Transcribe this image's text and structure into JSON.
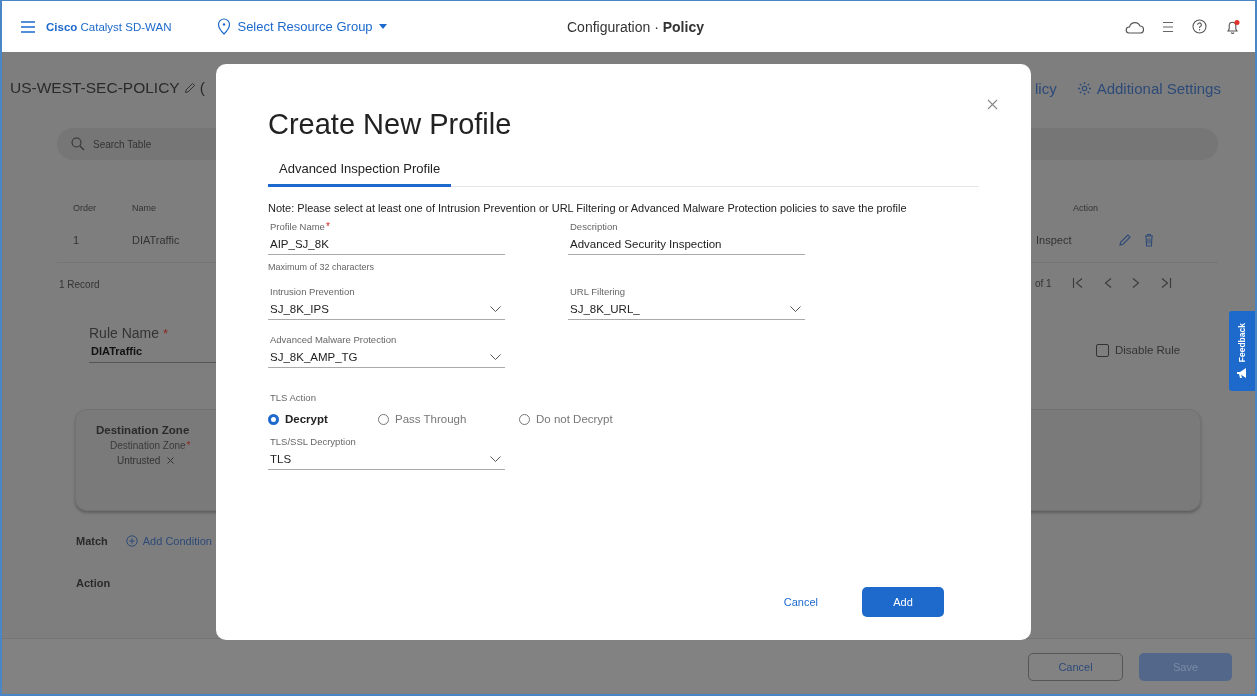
{
  "top_bar": {
    "product": "**Cisco** Catalyst SD-WAN",
    "resource_group": "Select Resource Group",
    "title": "Configuration · **Policy**"
  },
  "policy_header": {
    "title": "US-WEST-SEC-POLICY",
    "cut_text": "(",
    "cut_link": "licy",
    "additional_settings": "Additional Settings"
  },
  "search": {
    "placeholder": "Search Table"
  },
  "table": {
    "columns": [
      "Order",
      "Name",
      "Action"
    ],
    "rows": [
      {
        "order": "1",
        "name": "DIATraffic",
        "action": "Inspect"
      }
    ],
    "record_count": "1 Record",
    "page_info": "of 1"
  },
  "rule": {
    "label": "Rule Name",
    "required_mark": "*",
    "value": "DIATraffic",
    "disable_label": "Disable Rule",
    "disable_checked": false
  },
  "destination": {
    "title": "Destination Zone",
    "label": "Destination Zone",
    "required_mark": "*",
    "chip": "Untrusted"
  },
  "match": {
    "label": "Match",
    "link": "Add Condition"
  },
  "action_label": "Action",
  "footer": {
    "cancel": "Cancel",
    "save": "Save",
    "save_disabled": true
  },
  "feedback": "Feedback",
  "modal": {
    "title": "Create New Profile",
    "tabs": [
      {
        "label": "Advanced Inspection Profile",
        "selected": true
      }
    ],
    "note": "Note: Please select at least one of Intrusion Prevention or URL Filtering or Advanced Malware Protection policies to save the profile",
    "fields": [
      {
        "kind": "text",
        "label": "Profile Name",
        "required_mark": "*",
        "value": "AIP_SJ_8K",
        "hint": "Maximum of 32 characters"
      },
      {
        "kind": "text",
        "label": "Description",
        "value": "Advanced Security Inspection"
      },
      {
        "kind": "select",
        "label": "Intrusion Prevention",
        "value": "SJ_8K_IPS"
      },
      {
        "kind": "select",
        "label": "URL Filtering",
        "value": "SJ_8K_URL_"
      },
      {
        "kind": "select",
        "label": "Advanced Malware Protection",
        "value": "SJ_8K_AMP_TG"
      }
    ],
    "tls_action": {
      "label": "TLS Action",
      "options": [
        {
          "label": "Decrypt",
          "selected": true
        },
        {
          "label": "Pass Through",
          "selected": false
        },
        {
          "label": "Do not Decrypt",
          "selected": false
        }
      ]
    },
    "tls_decryption": {
      "kind": "select",
      "label": "TLS/SSL Decryption",
      "value": "TLS"
    },
    "cancel": "Cancel",
    "add": "Add"
  }
}
